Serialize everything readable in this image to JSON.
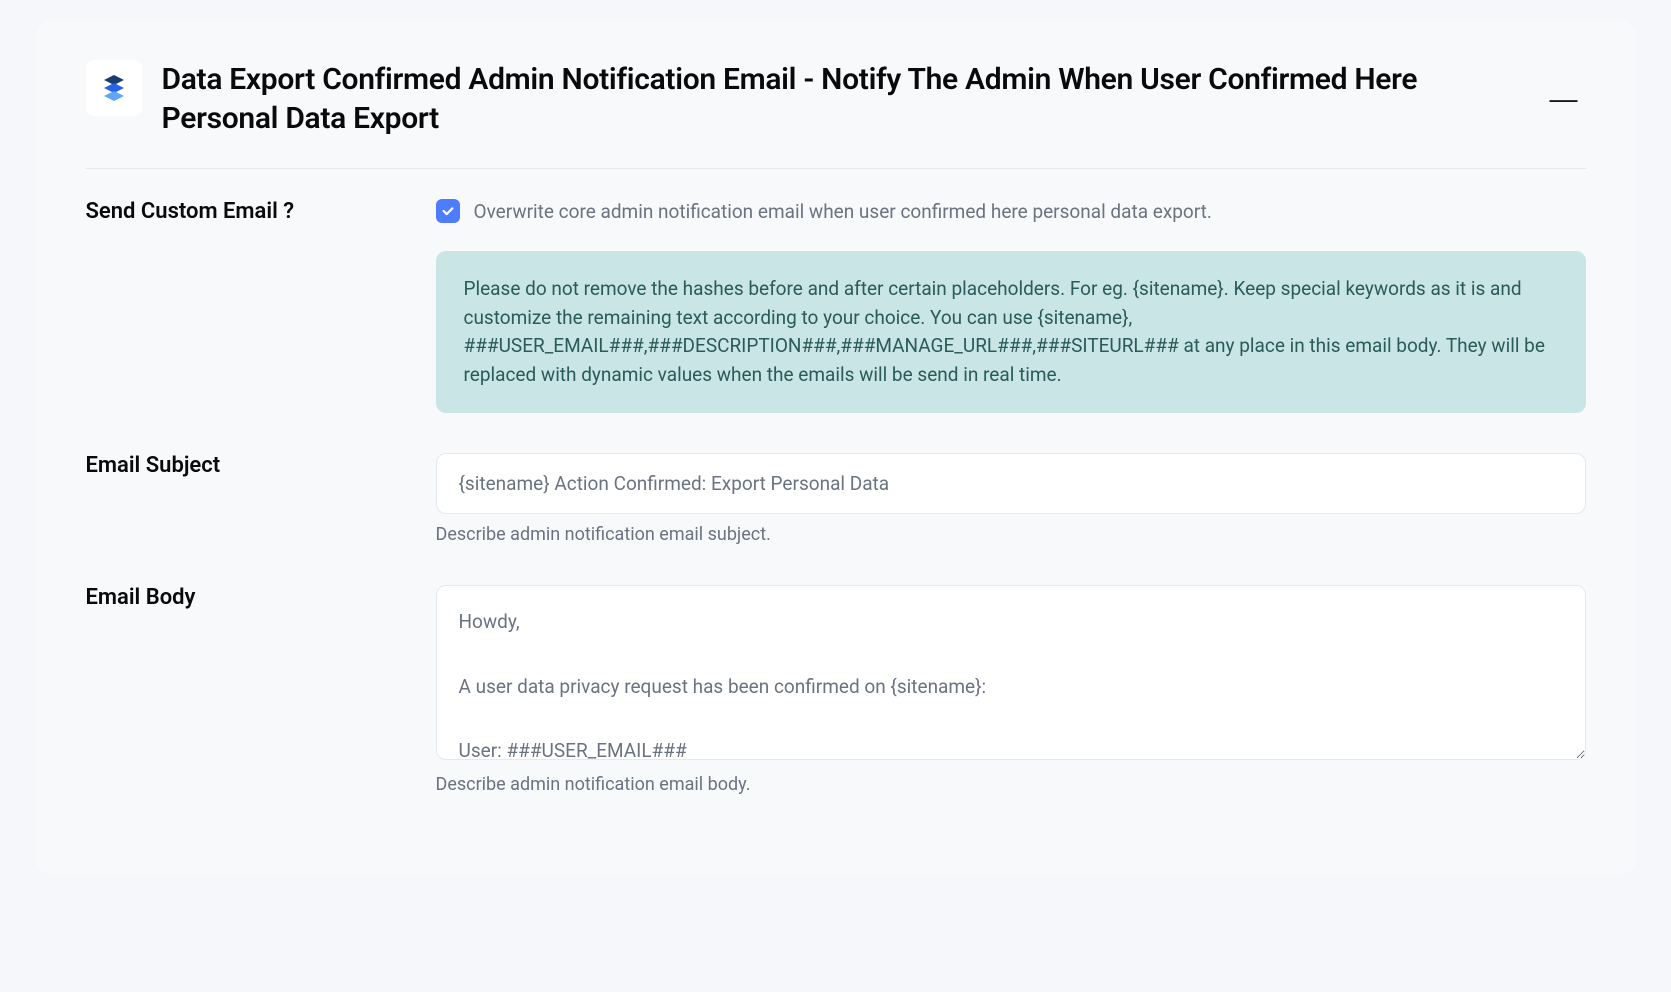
{
  "header": {
    "title": "Data Export Confirmed Admin Notification Email - Notify The Admin When User Confirmed Here Personal Data Export"
  },
  "fields": {
    "sendCustom": {
      "label": "Send Custom Email ?",
      "checkboxLabel": "Overwrite core admin notification email when user confirmed here personal data export.",
      "infoText": "Please do not remove the hashes before and after certain placeholders. For eg. {sitename}. Keep special keywords as it is and customize the remaining text according to your choice. You can use {sitename}, ###USER_EMAIL###,###DESCRIPTION###,###MANAGE_URL###,###SITEURL### at any place in this email body. They will be replaced with dynamic values when the emails will be send in real time."
    },
    "emailSubject": {
      "label": "Email Subject",
      "value": "{sitename} Action Confirmed: Export Personal Data",
      "helper": "Describe admin notification email subject."
    },
    "emailBody": {
      "label": "Email Body",
      "value": "Howdy,\n\nA user data privacy request has been confirmed on {sitename}:\n\nUser: ###USER_EMAIL###\nRequest: ###DESCRIPTION###",
      "helper": "Describe admin notification email body."
    }
  }
}
